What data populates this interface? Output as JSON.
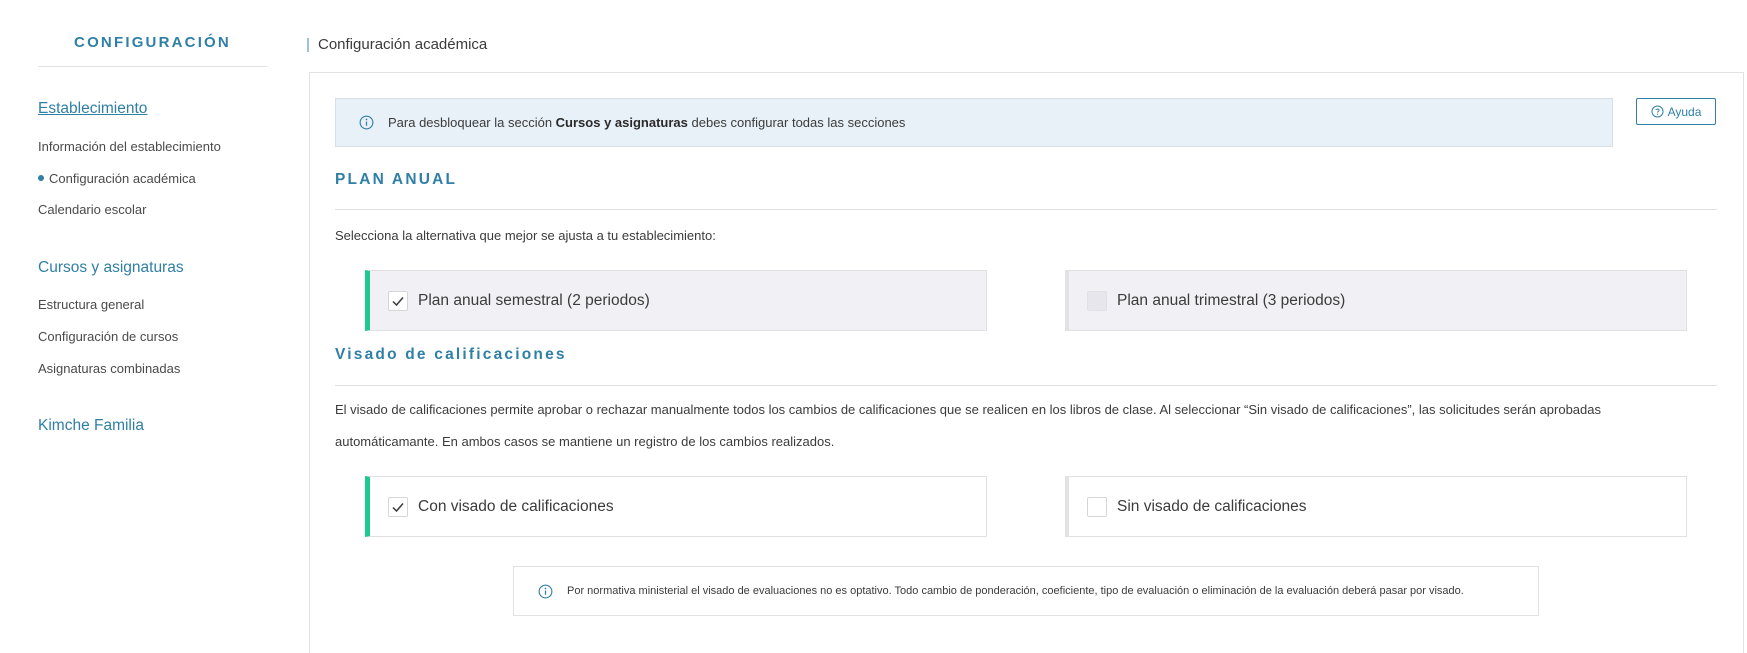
{
  "sidebar": {
    "title": "CONFIGURACIÓN",
    "sections": [
      {
        "label": "Establecimiento",
        "items": [
          {
            "label": "Información del establecimiento"
          },
          {
            "label": "Configuración académica"
          },
          {
            "label": "Calendario escolar"
          }
        ]
      },
      {
        "label": "Cursos y asignaturas",
        "items": [
          {
            "label": "Estructura general"
          },
          {
            "label": "Configuración de cursos"
          },
          {
            "label": "Asignaturas combinadas"
          }
        ]
      },
      {
        "label": "Kimche Familia",
        "items": []
      }
    ]
  },
  "header": {
    "title": "Configuración académica"
  },
  "banner": {
    "prefix": "Para desbloquear la sección ",
    "bold": "Cursos y asignaturas",
    "suffix": " debes configurar todas las secciones",
    "icon": "info-icon"
  },
  "help_button": {
    "label": "Ayuda",
    "icon": "question-circle-icon"
  },
  "plan_anual": {
    "title": "PLAN ANUAL",
    "description": "Selecciona la alternativa que mejor se ajusta a tu establecimiento:",
    "options": [
      {
        "label": "Plan anual semestral (2 periodos)",
        "selected": true
      },
      {
        "label": "Plan anual trimestral (3 periodos)",
        "selected": false
      }
    ]
  },
  "visado": {
    "title": "Visado de calificaciones",
    "description_line1": "El visado de calificaciones permite aprobar o rechazar manualmente todos los cambios de calificaciones que se realicen en los libros de clase. Al seleccionar “Sin visado de calificaciones”, las solicitudes serán aprobadas",
    "description_line2": "automáticamante. En ambos casos se mantiene un registro de los cambios realizados.",
    "options": [
      {
        "label": "Con visado de calificaciones",
        "selected": true
      },
      {
        "label": "Sin visado de calificaciones",
        "selected": false
      }
    ],
    "notice": "Por normativa ministerial el visado de evaluaciones no es optativo. Todo cambio de ponderación, coeficiente, tipo de evaluación o eliminación de la evaluación deberá pasar por visado."
  },
  "colors": {
    "accent": "#2f7fa6",
    "selected_bar": "#1ec98f",
    "banner_bg": "#e9f1f8"
  }
}
